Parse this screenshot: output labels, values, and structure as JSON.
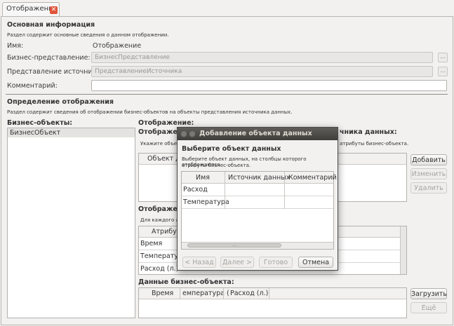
{
  "tab": {
    "label": "Отображение",
    "close_glyph": "✕"
  },
  "basic": {
    "heading": "Основная информация",
    "desc": "Раздел содержит основные сведения о данном отображении.",
    "name_label": "Имя:",
    "name_value": "Отображение",
    "business_label": "Бизнес-представление:",
    "business_placeholder": "БизнесПредставление",
    "source_label": "Представление источника:",
    "source_placeholder": "ПредставлениеИсточника",
    "comment_label": "Комментарий:",
    "browse": "..."
  },
  "definition": {
    "heading": "Определение отображения",
    "desc": "Раздел содержит сведения об отображении бизнес-объектов на объекты представления источника данных.",
    "objects_label": "Бизнес-объекты:",
    "objects": [
      "БизнесОбъект"
    ],
    "mapping_label": "Отображение:",
    "mapping_sub_label": "Отображение",
    "mapping_sub_label_right": "чника данных:",
    "mapping_hint": "Укажите объект",
    "mapping_hint_right": "атрибуты бизнес-объекта.",
    "object_col": "Объект да",
    "add": "Добавить",
    "change": "Изменить",
    "delete": "Удалить",
    "attr_heading": "Отображение",
    "attr_hint": "Для каждого атр",
    "attr_col": "Атрибут",
    "attr_rows": [
      "Время",
      "Температур",
      "Расход (л.)"
    ],
    "data_heading": "Данные бизнес-объекта:",
    "data_cols": [
      "Время",
      "емпература (",
      "Расход (л.)"
    ],
    "load": "Загрузить",
    "more": "Ещё"
  },
  "dialog": {
    "title": "Добавление объекта данных",
    "heading": "Выберите объект данных",
    "desc_line1": "Выберите объект данных, на столбцы которого отображаются",
    "desc_line2": "атрибуты бизнес-объекта.",
    "columns": [
      "Имя",
      "Источник данных",
      "Комментарий"
    ],
    "rows": [
      "Расход",
      "Температура"
    ],
    "back": "< Назад",
    "next": "Далее >",
    "finish": "Готово",
    "cancel": "Отмена",
    "scroll_dots": "..."
  },
  "colors": {
    "accent_close": "#e0553a",
    "titlebar": "#3f3e3b",
    "selection": "#e4e3e1"
  }
}
